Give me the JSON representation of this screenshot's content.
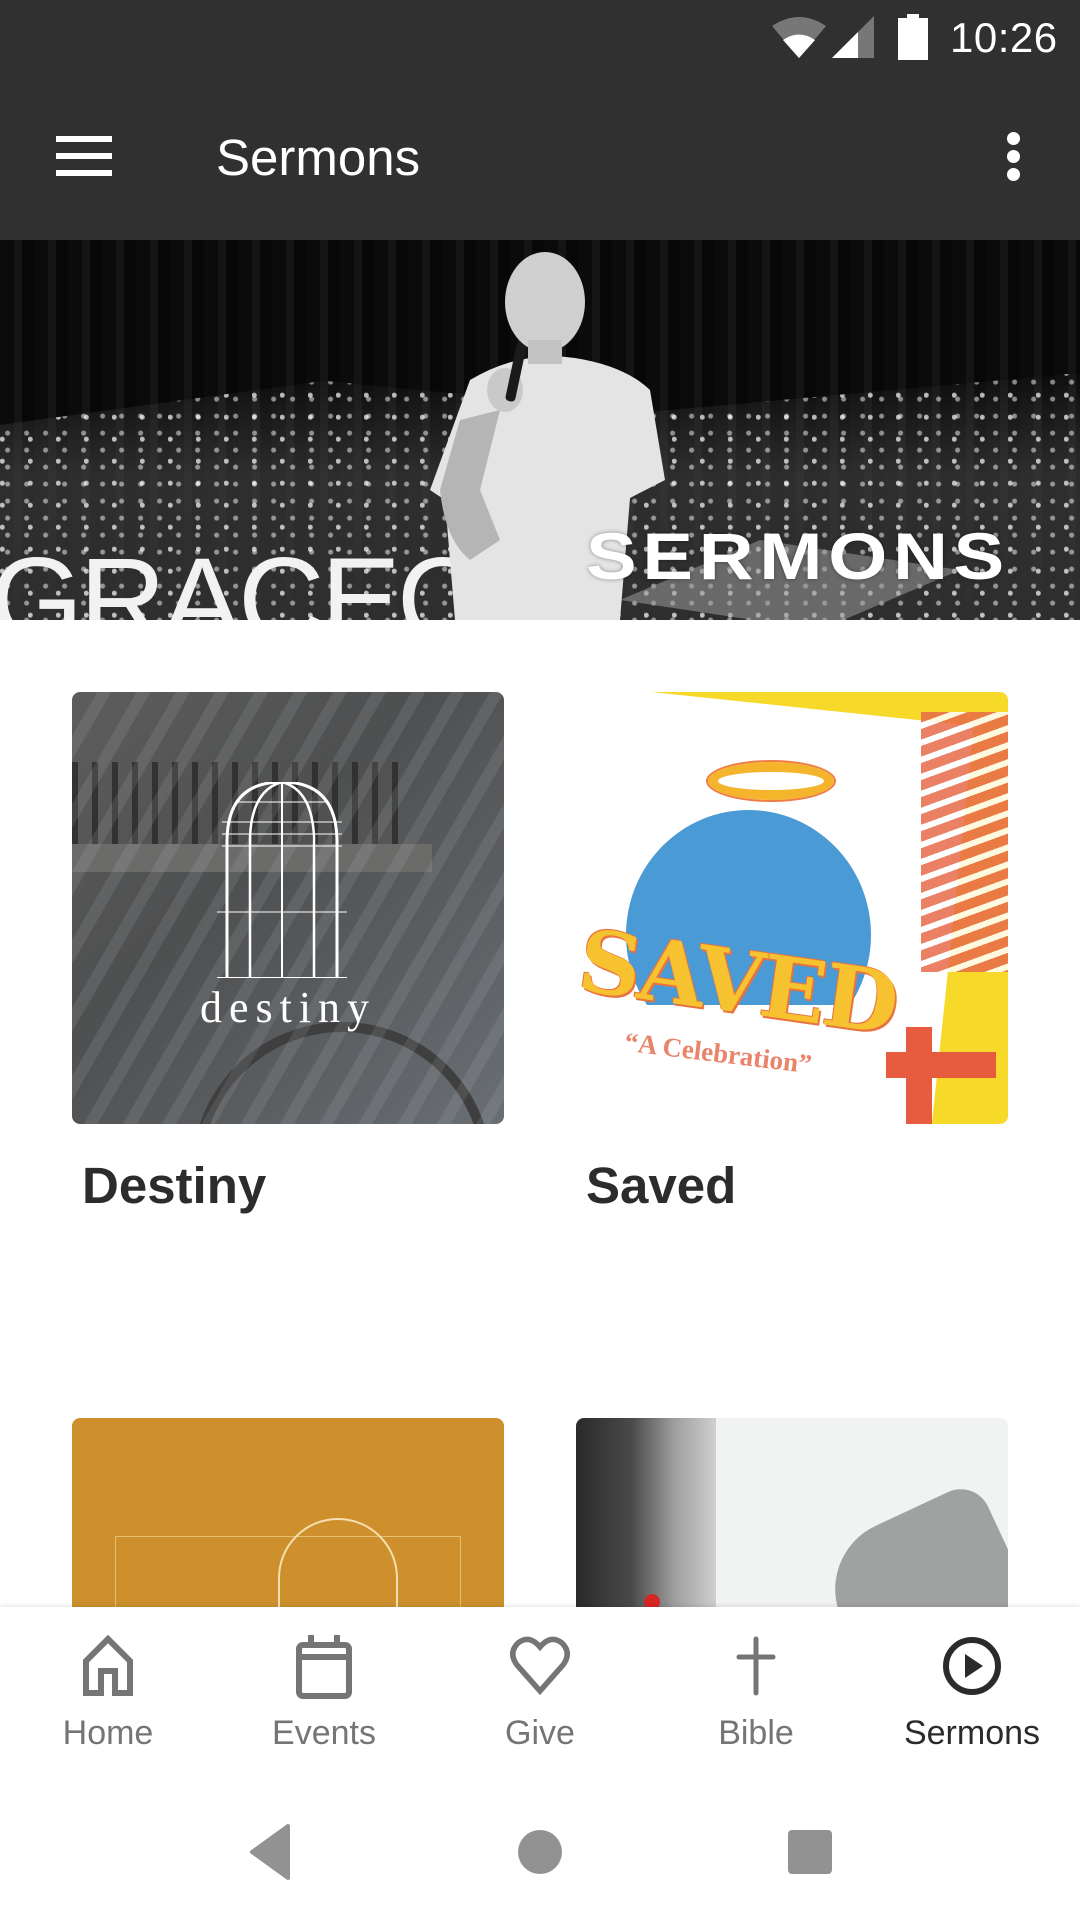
{
  "status_bar": {
    "time": "10:26",
    "icons": [
      "wifi-icon",
      "cellular-signal-icon",
      "battery-icon"
    ]
  },
  "toolbar": {
    "menu_icon": "hamburger-menu-icon",
    "title": "Sermons",
    "overflow_icon": "more-vert-icon"
  },
  "banner": {
    "title": "SERMONS",
    "background_text": "GRACECI"
  },
  "series": [
    {
      "title": "Destiny",
      "artwork_text": "destiny"
    },
    {
      "title": "Saved",
      "artwork_text": "SAVED",
      "artwork_subtitle": "“A Celebration”"
    },
    {
      "title": ""
    },
    {
      "title": ""
    }
  ],
  "bottom_nav": {
    "active": "Sermons",
    "items": [
      {
        "label": "Home",
        "icon": "home-icon"
      },
      {
        "label": "Events",
        "icon": "calendar-icon"
      },
      {
        "label": "Give",
        "icon": "heart-icon"
      },
      {
        "label": "Bible",
        "icon": "cross-icon"
      },
      {
        "label": "Sermons",
        "icon": "play-circle-icon"
      }
    ]
  },
  "system_nav": {
    "buttons": [
      "back",
      "home",
      "recents"
    ]
  },
  "colors": {
    "app_bar": "#303030",
    "nav_inactive": "#757575",
    "nav_active": "#2b2b2b",
    "card_title": "#2c2c2c",
    "gold_card": "#cd902c",
    "system_nav_icon": "#929292"
  }
}
